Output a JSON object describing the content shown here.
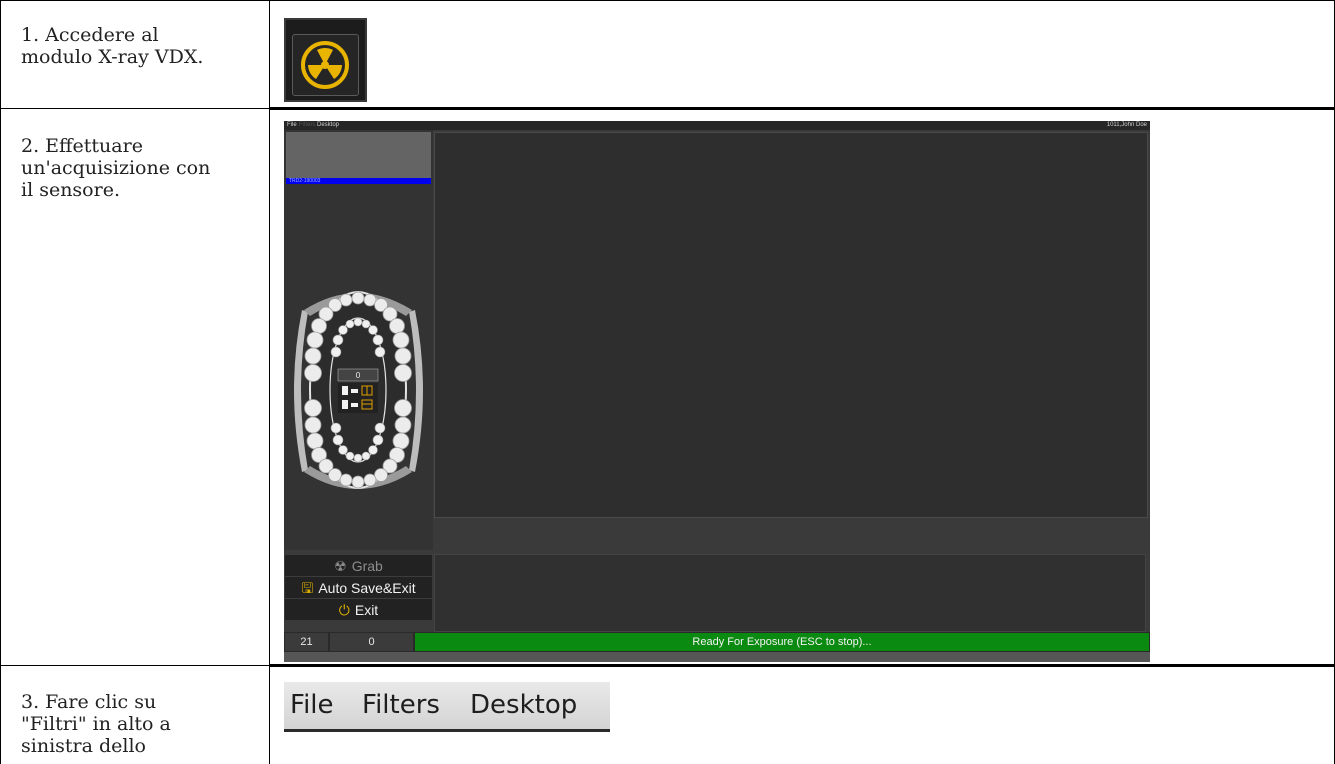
{
  "steps": [
    {
      "text_lines": [
        "1. Accedere al",
        "modulo X-ray VDX."
      ]
    },
    {
      "text_lines": [
        "2. Effettuare",
        "un'acquisizione con",
        "il sensore."
      ]
    },
    {
      "text_lines": [
        "3. Fare clic su",
        "\"Filtri\" in alto a",
        "sinistra dello"
      ]
    }
  ],
  "icon": {
    "name": "radiation-icon",
    "color": "#e8b400"
  },
  "app": {
    "menu": [
      "File",
      "Filters",
      "Desktop"
    ],
    "user": "1011,John Doe",
    "patient_item": "TRD2-190003",
    "counter": "0",
    "buttons": {
      "grab": "Grab",
      "auto_save": "Auto Save&Exit",
      "exit": "Exit"
    },
    "status": {
      "left": "21",
      "middle": "0",
      "message": "Ready For Exposure (ESC to stop)..."
    },
    "status_color": "#0a8a10"
  },
  "menubar_crop": {
    "items": [
      "File",
      "Filters",
      "Desktop"
    ]
  }
}
